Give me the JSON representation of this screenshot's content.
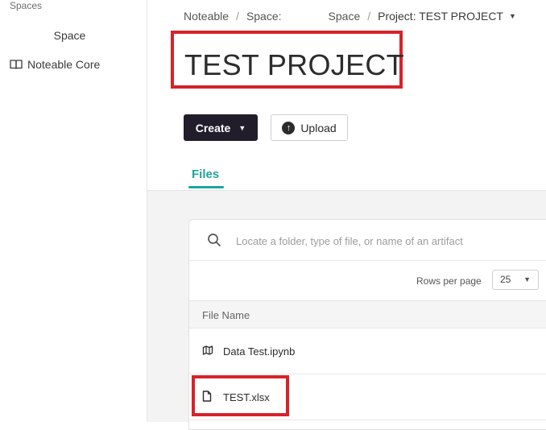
{
  "sidebar": {
    "section_label": "Spaces",
    "space_label": "Space",
    "items": [
      {
        "label": "Noteable Core",
        "icon": "book-icon"
      }
    ]
  },
  "breadcrumb": {
    "items": [
      "Noteable",
      "Space:",
      "Space",
      "Project: TEST PROJECT"
    ],
    "separator": "/"
  },
  "project": {
    "title": "TEST PROJECT"
  },
  "toolbar": {
    "create_label": "Create",
    "upload_label": "Upload"
  },
  "tabs": [
    {
      "label": "Files",
      "active": true
    }
  ],
  "files": {
    "search_placeholder": "Locate a folder, type of file, or name of an artifact",
    "rows_per_page_label": "Rows per page",
    "rows_per_page_value": "25",
    "column_header": "File Name",
    "rows": [
      {
        "name": "Data Test.ipynb",
        "icon": "notebook-icon"
      },
      {
        "name": "TEST.xlsx",
        "icon": "file-icon"
      }
    ]
  },
  "colors": {
    "accent": "#1ea59b",
    "primary_button": "#211d2b",
    "highlight_box": "#d7222a"
  }
}
